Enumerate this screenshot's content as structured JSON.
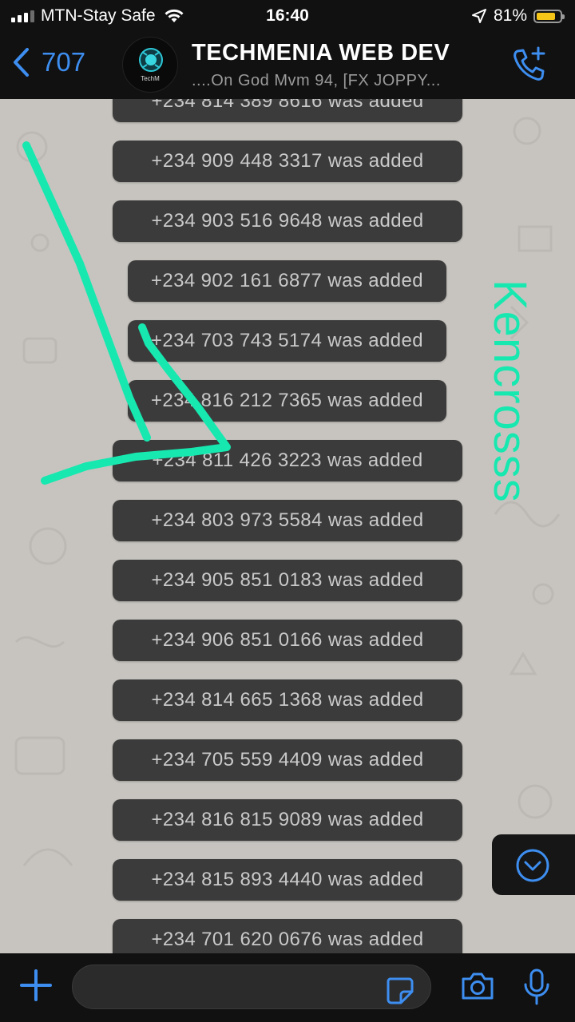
{
  "status_bar": {
    "carrier": "MTN-Stay Safe",
    "time": "16:40",
    "battery": "81%",
    "battery_level": 0.81
  },
  "header": {
    "back_count": "707",
    "group_name": "TECHMENIA WEB DEV",
    "members_preview": "....On God Mvm 94, [FX JOPPY...",
    "avatar_text": "TechM"
  },
  "messages": [
    "+234 814 389 8616 was added",
    "+234 909 448 3317 was added",
    "+234 903 516 9648 was added",
    "+234 902 161 6877 was added",
    "+234 703 743 5174 was added",
    "+234 816 212 7365 was added",
    "+234 811 426 3223 was added",
    "+234 803 973 5584 was added",
    "+234 905 851 0183 was added",
    "+234 906 851 0166 was added",
    "+234 814 665 1368 was added",
    "+234 705 559 4409 was added",
    "+234 816 815 9089 was added",
    "+234 815 893 4440 was added",
    "+234 701 620 0676 was added"
  ],
  "annotation": {
    "handwritten_text": "Kencrosss",
    "color": "#17e8b0"
  },
  "colors": {
    "accent": "#3d8ef0",
    "bar_background": "#111111",
    "chat_background": "#c7c4bf",
    "pill_background": "#3b3b3b"
  },
  "icons": [
    "back-chevron-icon",
    "add-call-icon",
    "scroll-down-icon",
    "plus-icon",
    "sticker-icon",
    "camera-icon",
    "mic-icon",
    "wifi-icon",
    "location-icon"
  ]
}
